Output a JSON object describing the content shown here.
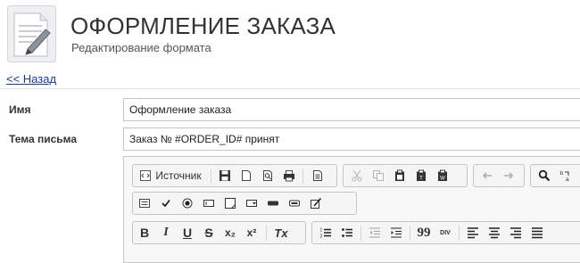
{
  "header": {
    "title": "ОФОРМЛЕНИЕ ЗАКАЗА",
    "subtitle": "Редактирование формата"
  },
  "nav": {
    "back_label": "<< Назад"
  },
  "form": {
    "name_label": "Имя",
    "name_value": "Оформление заказа",
    "subject_label": "Тема письма",
    "subject_value": "Заказ № #ORDER_ID# принят"
  },
  "editor": {
    "source_label": "Источник",
    "bold": "B",
    "italic": "I",
    "underline": "U",
    "strike": "S",
    "subscript": "x₂",
    "superscript": "x²",
    "remove_format": "Tx",
    "blockquote": "99",
    "div": "DIV"
  }
}
